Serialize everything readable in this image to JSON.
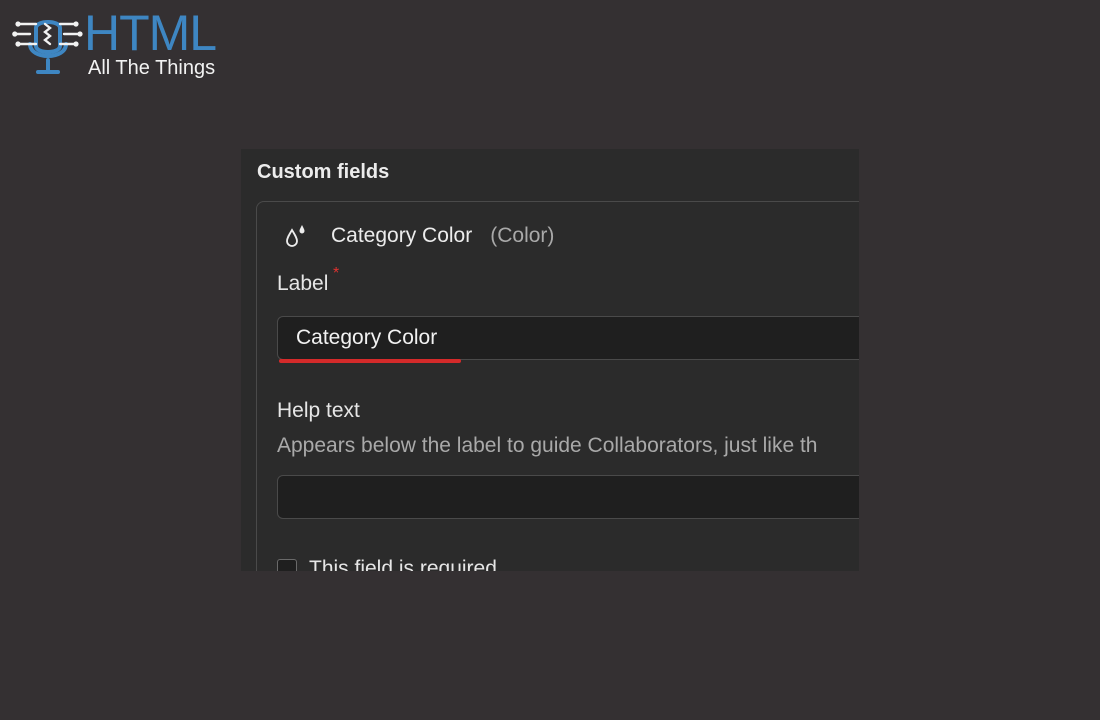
{
  "logo": {
    "title": "HTML",
    "subtitle": "All The Things",
    "colors": {
      "title": "#3e86c2",
      "subtitle": "#f2f2f2"
    }
  },
  "panel": {
    "title": "Custom fields",
    "field": {
      "icon": "color-drop-icon",
      "name": "Category Color",
      "type": "(Color)",
      "label_title": "Label",
      "required_mark": "*",
      "label_value": "Category Color",
      "help_title": "Help text",
      "help_description": "Appears below the label to guide Collaborators, just like th",
      "help_value": "",
      "required_text": "This field is required",
      "required_checked": false
    }
  },
  "colors": {
    "background": "#343032",
    "panel": "#2b2b2b",
    "input": "#1f1f1f",
    "required_mark": "#e0322f",
    "spellcheck_underline": "#d42a2a"
  }
}
